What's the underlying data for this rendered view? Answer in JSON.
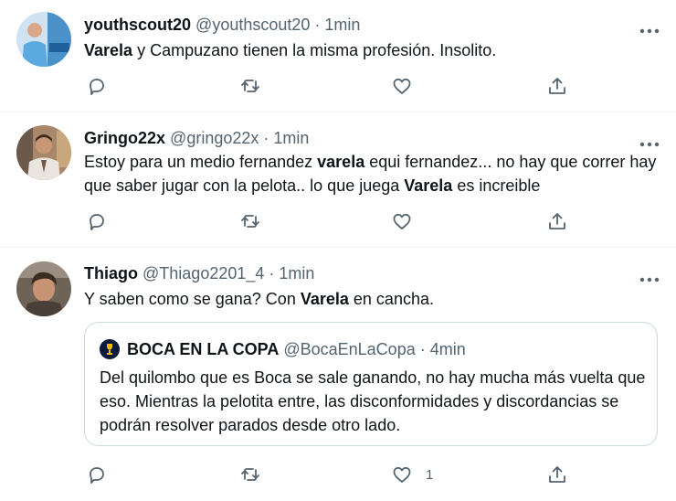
{
  "tweets": [
    {
      "display_name": "youthscout20",
      "handle": "@youthscout20",
      "time": "· 1min",
      "segments": [
        {
          "text": "Varela",
          "bold": true
        },
        {
          "text": " y Campuzano tienen la misma profesión. Insolito.",
          "bold": false
        }
      ],
      "like_count": ""
    },
    {
      "display_name": "Gringo22x",
      "handle": "@gringo22x",
      "time": "· 1min",
      "segments": [
        {
          "text": "Estoy para un medio fernandez ",
          "bold": false
        },
        {
          "text": "varela",
          "bold": true
        },
        {
          "text": " equi fernandez... no hay que correr hay que saber jugar con la pelota.. lo que juega ",
          "bold": false
        },
        {
          "text": "Varela",
          "bold": true
        },
        {
          "text": " es increible",
          "bold": false
        }
      ],
      "like_count": ""
    },
    {
      "display_name": "Thiago",
      "handle": "@Thiago2201_4",
      "time": "· 1min",
      "segments": [
        {
          "text": "Y saben como se gana? Con ",
          "bold": false
        },
        {
          "text": "Varela",
          "bold": true
        },
        {
          "text": " en cancha.",
          "bold": false
        }
      ],
      "like_count": "1"
    }
  ],
  "quote": {
    "display_name": "BOCA EN LA COPA",
    "handle": "@BocaEnLaCopa",
    "time": "· 4min",
    "text": "Del quilombo que es Boca se sale ganando, no hay mucha más vuelta que eso. Mientras la pelotita entre, las disconformidades y discordancias se podrán resolver parados desde otro lado."
  },
  "icons": [
    "reply-icon",
    "retweet-icon",
    "like-icon",
    "share-icon",
    "more-icon"
  ],
  "colors": {
    "icon_gray": "#536471",
    "border": "#eff3f4",
    "text": "#0f1419"
  }
}
